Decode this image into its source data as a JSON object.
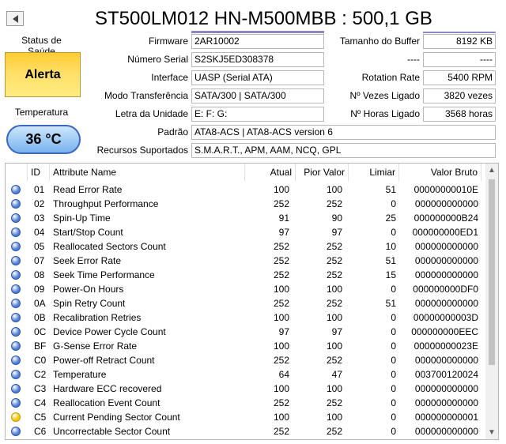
{
  "colors": {
    "alert_bg": "#ffd94d",
    "temp_bg": "#9ccaf4",
    "temp_border": "#3a68c4",
    "ball_good": "#4f7fd9",
    "ball_caution": "#f5c400",
    "accent": "#8a86c8"
  },
  "header": {
    "back_icon": "left-arrow-icon",
    "title": "ST500LM012 HN-M500MBB : 500,1 GB"
  },
  "health": {
    "label": "Status de Saúde",
    "status": "Alerta"
  },
  "temperature": {
    "label": "Temperatura",
    "value": "36 °C"
  },
  "info_left": [
    {
      "label": "Firmware",
      "value": "2AR10002"
    },
    {
      "label": "Número Serial",
      "value": "S2SKJ5ED308378"
    },
    {
      "label": "Interface",
      "value": "UASP (Serial ATA)"
    },
    {
      "label": "Modo Transferência",
      "value": "SATA/300 | SATA/300"
    },
    {
      "label": "Letra da Unidade",
      "value": "E: F: G:"
    }
  ],
  "info_right": [
    {
      "label": "Tamanho do Buffer",
      "value": "8192 KB"
    },
    {
      "label": "----",
      "value": "----"
    },
    {
      "label": "Rotation Rate",
      "value": "5400 RPM"
    },
    {
      "label": "Nº Vezes Ligado",
      "value": "3820 vezes"
    },
    {
      "label": "Nº Horas Ligado",
      "value": "3568 horas"
    }
  ],
  "standard": {
    "label": "Padrão",
    "value": "ATA8-ACS | ATA8-ACS version 6"
  },
  "features": {
    "label": "Recursos Suportados",
    "value": "S.M.A.R.T., APM, AAM, NCQ, GPL"
  },
  "table": {
    "columns": [
      "ID",
      "Attribute Name",
      "Atual",
      "Pior Valor",
      "Limiar",
      "Valor Bruto"
    ],
    "rows": [
      {
        "status": "good",
        "id": "01",
        "name": "Read Error Rate",
        "current": "100",
        "worst": "100",
        "threshold": "51",
        "raw": "00000000010E"
      },
      {
        "status": "good",
        "id": "02",
        "name": "Throughput Performance",
        "current": "252",
        "worst": "252",
        "threshold": "0",
        "raw": "000000000000"
      },
      {
        "status": "good",
        "id": "03",
        "name": "Spin-Up Time",
        "current": "91",
        "worst": "90",
        "threshold": "25",
        "raw": "000000000B24"
      },
      {
        "status": "good",
        "id": "04",
        "name": "Start/Stop Count",
        "current": "97",
        "worst": "97",
        "threshold": "0",
        "raw": "000000000ED1"
      },
      {
        "status": "good",
        "id": "05",
        "name": "Reallocated Sectors Count",
        "current": "252",
        "worst": "252",
        "threshold": "10",
        "raw": "000000000000"
      },
      {
        "status": "good",
        "id": "07",
        "name": "Seek Error Rate",
        "current": "252",
        "worst": "252",
        "threshold": "51",
        "raw": "000000000000"
      },
      {
        "status": "good",
        "id": "08",
        "name": "Seek Time Performance",
        "current": "252",
        "worst": "252",
        "threshold": "15",
        "raw": "000000000000"
      },
      {
        "status": "good",
        "id": "09",
        "name": "Power-On Hours",
        "current": "100",
        "worst": "100",
        "threshold": "0",
        "raw": "000000000DF0"
      },
      {
        "status": "good",
        "id": "0A",
        "name": "Spin Retry Count",
        "current": "252",
        "worst": "252",
        "threshold": "51",
        "raw": "000000000000"
      },
      {
        "status": "good",
        "id": "0B",
        "name": "Recalibration Retries",
        "current": "100",
        "worst": "100",
        "threshold": "0",
        "raw": "00000000003D"
      },
      {
        "status": "good",
        "id": "0C",
        "name": "Device Power Cycle Count",
        "current": "97",
        "worst": "97",
        "threshold": "0",
        "raw": "000000000EEC"
      },
      {
        "status": "good",
        "id": "BF",
        "name": "G-Sense Error Rate",
        "current": "100",
        "worst": "100",
        "threshold": "0",
        "raw": "00000000023E"
      },
      {
        "status": "good",
        "id": "C0",
        "name": "Power-off Retract Count",
        "current": "252",
        "worst": "252",
        "threshold": "0",
        "raw": "000000000000"
      },
      {
        "status": "good",
        "id": "C2",
        "name": "Temperature",
        "current": "64",
        "worst": "47",
        "threshold": "0",
        "raw": "003700120024"
      },
      {
        "status": "good",
        "id": "C3",
        "name": "Hardware ECC recovered",
        "current": "100",
        "worst": "100",
        "threshold": "0",
        "raw": "000000000000"
      },
      {
        "status": "good",
        "id": "C4",
        "name": "Reallocation Event Count",
        "current": "252",
        "worst": "252",
        "threshold": "0",
        "raw": "000000000000"
      },
      {
        "status": "caution",
        "id": "C5",
        "name": "Current Pending Sector Count",
        "current": "100",
        "worst": "100",
        "threshold": "0",
        "raw": "000000000001"
      },
      {
        "status": "good",
        "id": "C6",
        "name": "Uncorrectable Sector Count",
        "current": "252",
        "worst": "252",
        "threshold": "0",
        "raw": "000000000000"
      }
    ]
  }
}
